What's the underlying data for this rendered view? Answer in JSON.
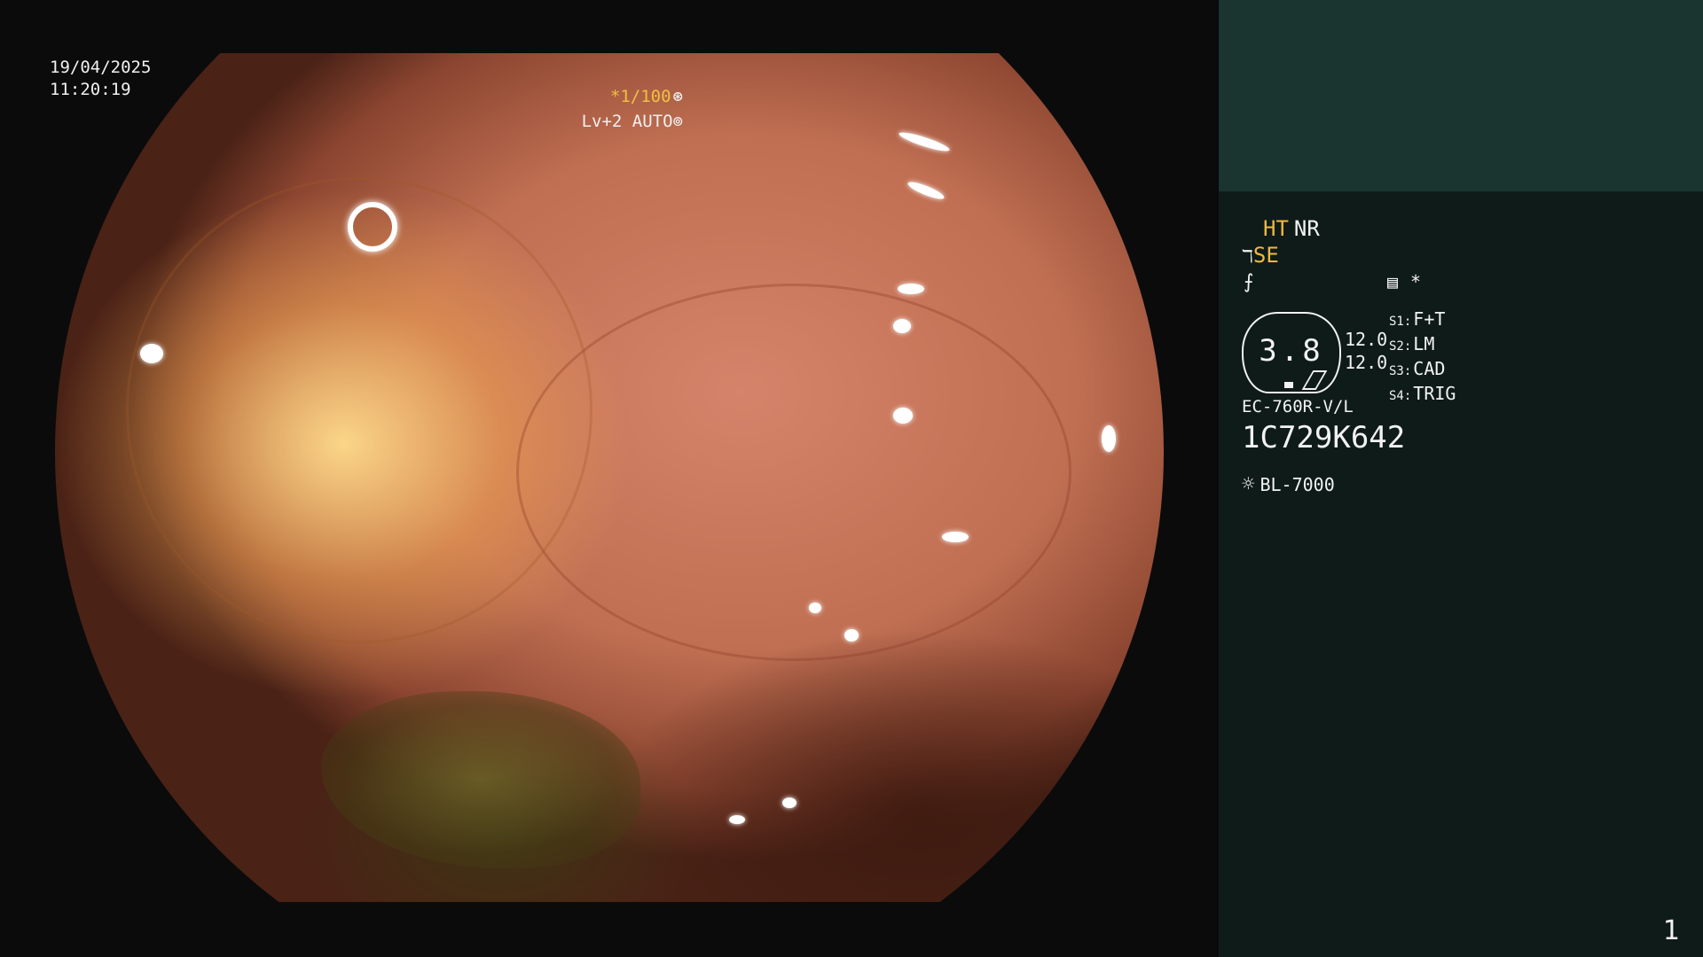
{
  "overlay": {
    "date": "19/04/2025",
    "time": "11:20:19",
    "shutter": "*1/100",
    "shutter_icon": "⊛",
    "level": "Lv+2 AUTO",
    "level_icon": "⊚"
  },
  "panel": {
    "ht": "HT",
    "nr": "NR",
    "se_symbol": "ℸ",
    "se": "SE",
    "enhance_symbol": "⨍",
    "setting_icon": "▤",
    "setting_star": "*",
    "gauge_value": "3.8",
    "value_1": "12.0",
    "value_2": "12.0",
    "switches": [
      {
        "key": "S1:",
        "label": "F+T"
      },
      {
        "key": "S2:",
        "label": "LM"
      },
      {
        "key": "S3:",
        "label": "CAD"
      },
      {
        "key": "S4:",
        "label": "TRIG"
      }
    ],
    "scope_model": "EC-760R-V/L",
    "scope_serial": "1C729K642",
    "light_icon": "☼",
    "light_source": "BL-7000",
    "page_number": "1"
  },
  "colors": {
    "accent_yellow": "#f0b840",
    "panel_top": "#1a3430",
    "panel_bg": "#0f1b19"
  }
}
